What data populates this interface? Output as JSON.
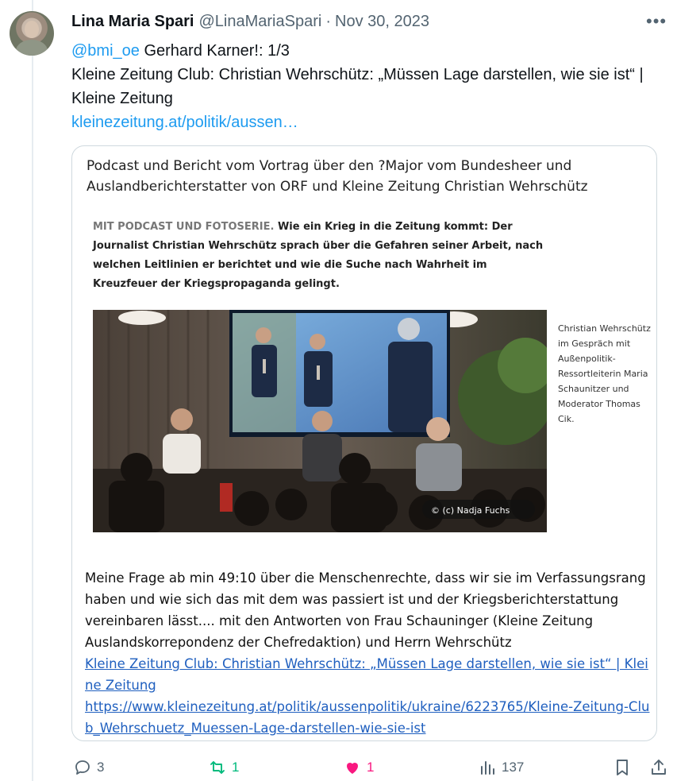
{
  "author": {
    "name": "Lina Maria Spari",
    "handle": "@LinaMariaSpari",
    "separator": "·",
    "date": "Nov 30, 2023"
  },
  "more_label": "•••",
  "tweet": {
    "mention": "@bmi_oe",
    "line1_rest": " Gerhard Karner!: 1/3",
    "line2": "Kleine Zeitung Club: Christian Wehrschütz: „Müssen Lage darstellen, wie sie ist“ | Kleine Zeitung",
    "link": "kleinezeitung.at/politik/aussen…"
  },
  "card": {
    "intro": "Podcast und Bericht vom Vortrag über den ?Major vom Bundesheer und Auslandberichterstatter von ORF und Kleine Zeitung Christian Wehrschütz",
    "article_kicker": "MIT PODCAST UND FOTOSERIE.",
    "article_text": " Wie ein Krieg in die Zeitung kommt: Der Journalist Christian Wehrschütz sprach über die Gefahren seiner Arbeit, nach welchen Leitlinien er berichtet und wie die Suche nach Wahrheit im Kreuzfeuer der Kriegspropaganda gelingt.",
    "photo_credit": "© (c) Nadja Fuchs",
    "caption": "Christian Wehrschütz im Gespräch mit Außenpolitik-Ressortleiterin Maria Schaunitzer und Moderator Thomas Cik.",
    "body": "Meine Frage ab min 49:10 über die Menschenrechte, dass wir sie im Verfassungsrang haben und wie sich das mit dem was passiert ist und der Kriegsberichterstattung vereinbaren lässt.... mit den Antworten von Frau Schauninger (Kleine Zeitung Auslandskorrepondenz der Chefredaktion) und Herrn Wehrschütz",
    "link1": "Kleine Zeitung Club: Christian Wehrschütz: „Müssen Lage darstellen, wie sie ist“ | Kleine Zeitung",
    "link2": "https://www.kleinezeitung.at/politik/aussenpolitik/ukraine/6223765/Kleine-Zeitung-Club_Wehrschuetz_Muessen-Lage-darstellen-wie-sie-ist"
  },
  "actions": {
    "replies": "3",
    "reposts": "1",
    "likes": "1",
    "views": "137"
  },
  "colors": {
    "accent": "#1d9bf0",
    "repost": "#00ba7c",
    "like": "#f91880",
    "muted": "#536471"
  }
}
